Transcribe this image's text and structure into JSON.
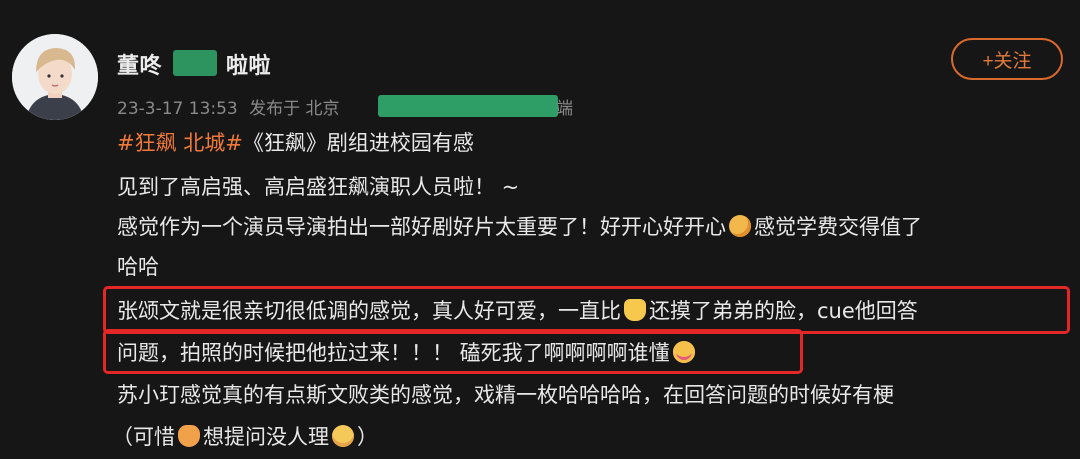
{
  "author": {
    "name_prefix": "董咚",
    "name_suffix": "啦啦",
    "follow_label": "+关注"
  },
  "meta": {
    "time": "23-3-17 13:53",
    "source_prefix": "发布于 北京",
    "source_tail": "端"
  },
  "post": {
    "line1_tag1": "#狂飙",
    "line1_tag2": "北城#",
    "line1_text": "《狂飙》剧组进校园有感",
    "line2": "见到了高启强、高启盛狂飙演职人员啦！ ~",
    "line3_a": "感觉作为一个演员导演拍出一部好剧好片太重要了！好开心好开心",
    "line3_b": "感觉学费交得值了",
    "line4": "哈哈",
    "line5_a": "张颂文就是很亲切很低调的感觉，真人好可爱，一直比",
    "line5_b": "还摸了弟弟的脸，cue他回答",
    "line6_a": "问题，拍照的时候把他拉过来！！！ 磕死我了啊啊啊啊谁懂",
    "line7": "苏小玎感觉真的有点斯文败类的感觉，戏精一枚哈哈哈哈，在回答问题的时候好有梗",
    "line8_a": "（可惜",
    "line8_b": "想提问没人理",
    "line8_c": "）"
  },
  "colors": {
    "accent": "#f0793a",
    "highlight": "#e32626",
    "redact": "#2f9e66"
  },
  "icons": {
    "emoji1": "hugging-face-icon",
    "emoji2": "victory-hand-icon",
    "emoji3": "heart-eyes-icon",
    "emoji4": "raising-hand-icon",
    "emoji5": "pleading-face-icon"
  }
}
